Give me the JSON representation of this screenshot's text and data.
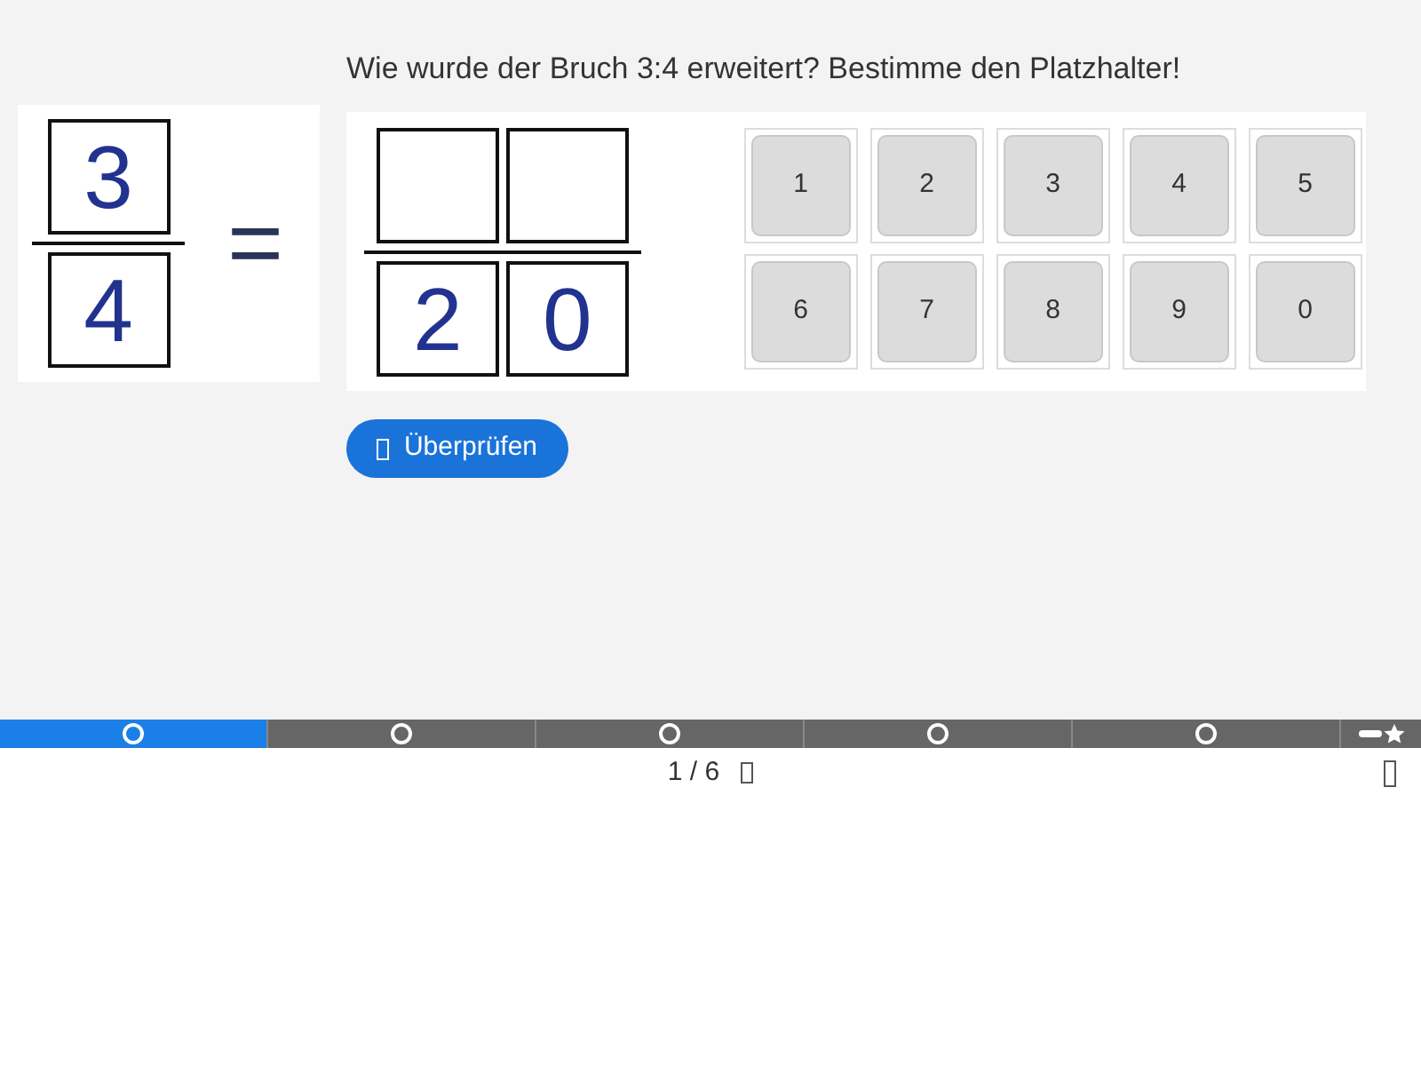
{
  "question": "Wie wurde der Bruch 3:4 erweitert? Bestimme den Platzhalter!",
  "left_fraction": {
    "numerator": "3",
    "denominator": "4"
  },
  "equals": "=",
  "right_fraction": {
    "numerator_slots": [
      {
        "filled": false
      },
      {
        "filled": false
      }
    ],
    "denominator": [
      "2",
      "0"
    ]
  },
  "keypad": [
    "1",
    "2",
    "3",
    "4",
    "5",
    "6",
    "7",
    "8",
    "9",
    "0"
  ],
  "check_button": {
    "label": "Überprüfen"
  },
  "progress": [
    {
      "selected": true
    },
    {
      "selected": false
    },
    {
      "selected": false
    },
    {
      "selected": false
    },
    {
      "selected": false
    }
  ],
  "pager": {
    "text": "1 / 6"
  }
}
